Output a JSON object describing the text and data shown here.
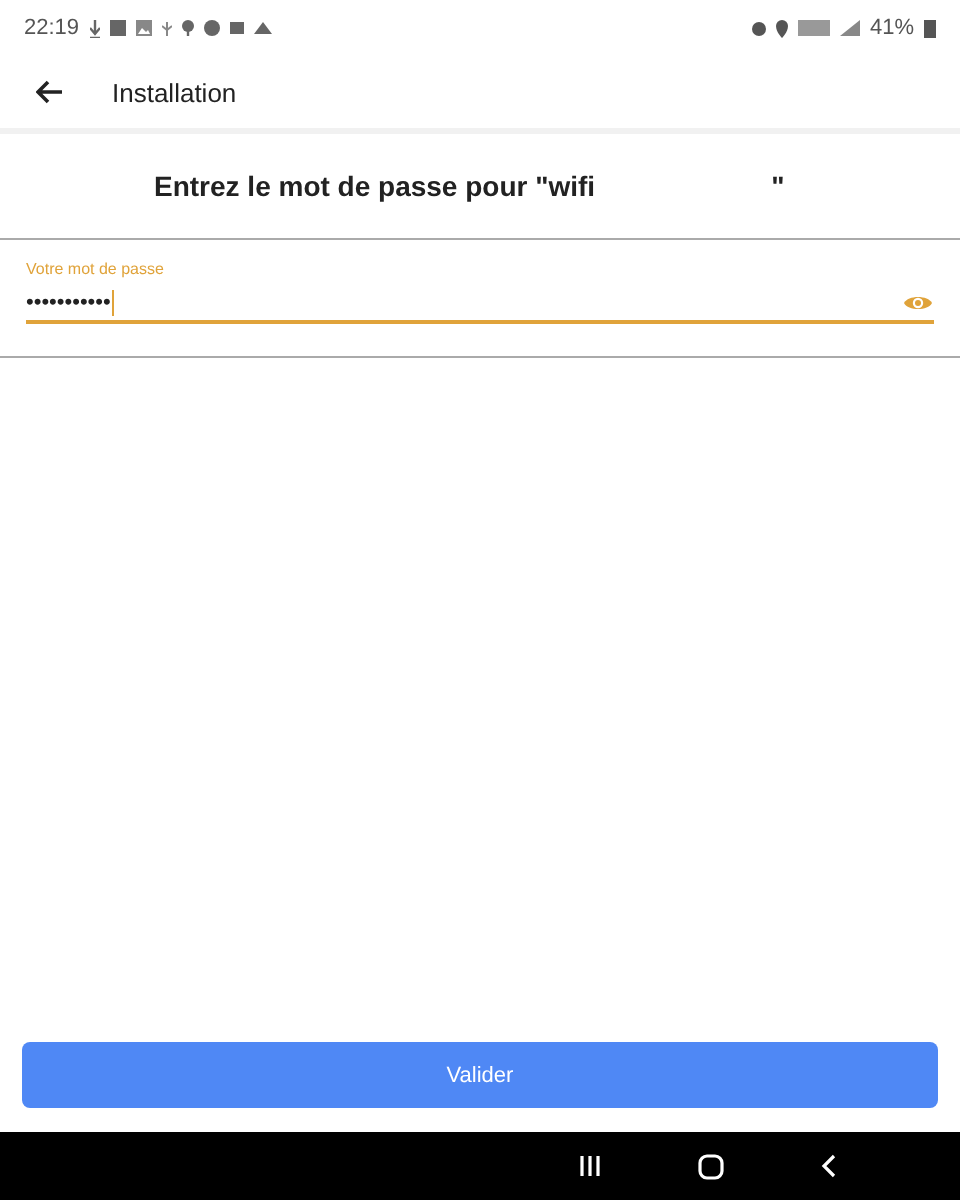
{
  "status_bar": {
    "time": "22:19",
    "battery": "41%"
  },
  "app_bar": {
    "title": "Installation"
  },
  "heading": {
    "text": "Entrez le mot de passe pour \"wifi",
    "closing_quote": "\""
  },
  "password_field": {
    "label": "Votre mot de passe",
    "value": "•••••••••••",
    "focused": true
  },
  "buttons": [
    "Valider"
  ]
}
